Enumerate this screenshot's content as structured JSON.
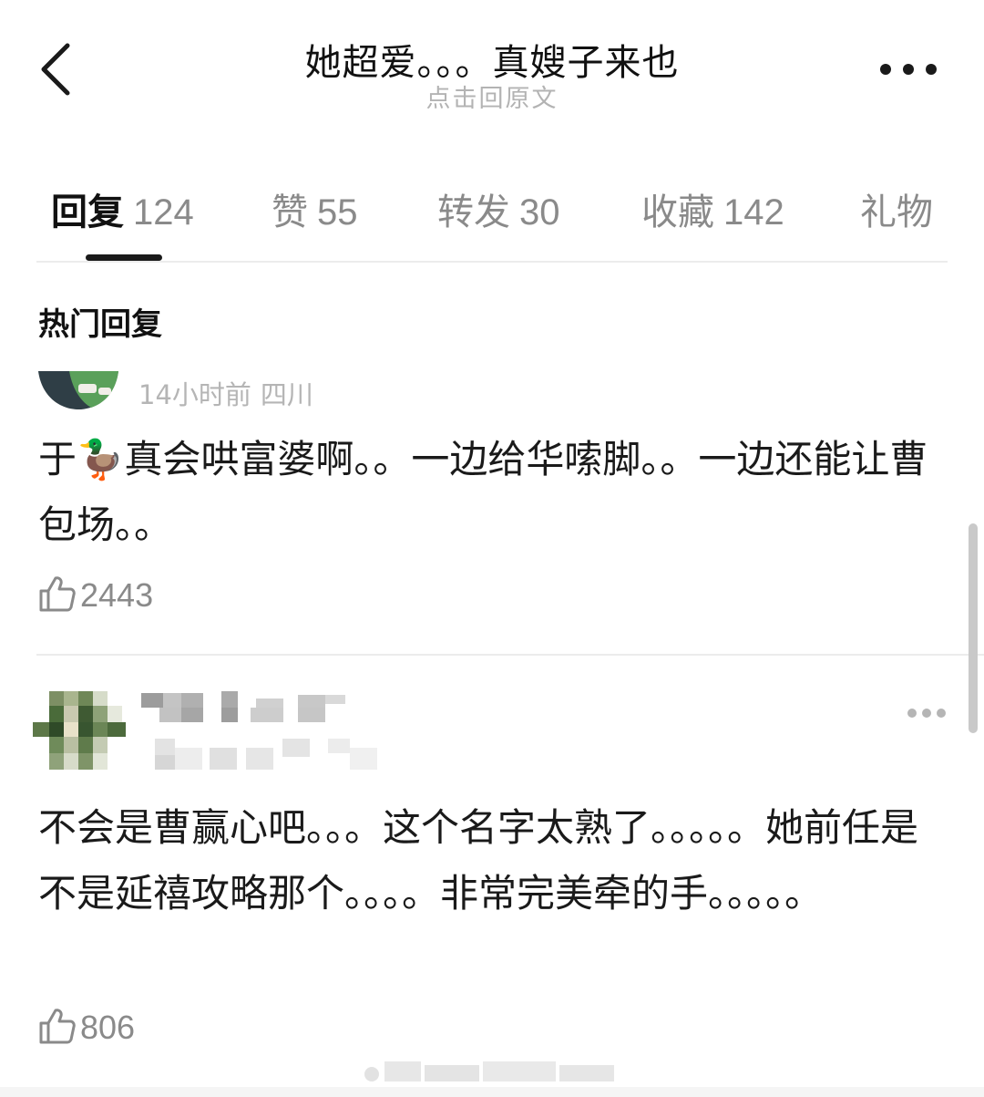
{
  "header": {
    "title": "她超爱。。。真嫂子来也",
    "subtitle": "点击回原文"
  },
  "tabs": [
    {
      "label": "回复",
      "count": "124",
      "active": true
    },
    {
      "label": "赞",
      "count": "55"
    },
    {
      "label": "转发",
      "count": "30"
    },
    {
      "label": "收藏",
      "count": "142"
    },
    {
      "label": "礼物",
      "count": ""
    }
  ],
  "section": {
    "title": "热门回复"
  },
  "comments": [
    {
      "time": "14小时前",
      "location": "四川",
      "text_before": "于",
      "emoji": "🦆",
      "text_after": "真会哄富婆啊。。一边给华嗦脚。。一边还能让曹包场。。",
      "likes": "2443"
    },
    {
      "text": "不会是曹赢心吧。。。这个名字太熟了。。。。。她前任是不是延禧攻略那个。。。。非常完美牵的手。。。。。",
      "likes": "806"
    }
  ],
  "colors": {
    "accent": "#1a1a1a",
    "muted": "#8a8a8a",
    "meta": "#b5b5b5",
    "divider": "#ececec"
  }
}
